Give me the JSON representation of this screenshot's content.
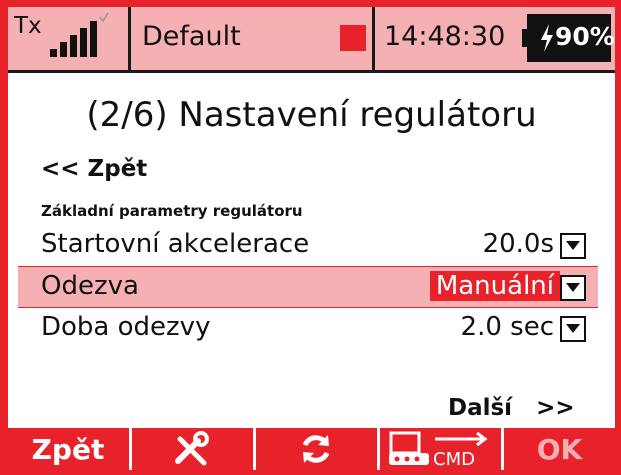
{
  "status_bar": {
    "tx_label": "Tx",
    "model_name": "Default",
    "time": "14:48:30",
    "battery": "90%",
    "icons": [
      "signal-bars-icon",
      "status-square-icon",
      "battery-charge-icon"
    ]
  },
  "page": {
    "title": "(2/6) Nastavení regulátoru",
    "back_link": "<< Zpět",
    "section_label": "Základní parametry regulátoru",
    "next_link": "Další   >>"
  },
  "rows": [
    {
      "label": "Startovní akcelerace",
      "value": "20.0s"
    },
    {
      "label": "Odezva",
      "value": "Manuální"
    },
    {
      "label": "Doba odezvy",
      "value": "2.0 sec"
    }
  ],
  "softkeys": {
    "back": "Zpět",
    "ok": "OK",
    "cmd": "CMD",
    "icons": [
      "tools-icon",
      "refresh-icon",
      "cmd-icon"
    ]
  },
  "colors": {
    "accent": "#e8222a",
    "highlight": "#f4b0b3"
  }
}
